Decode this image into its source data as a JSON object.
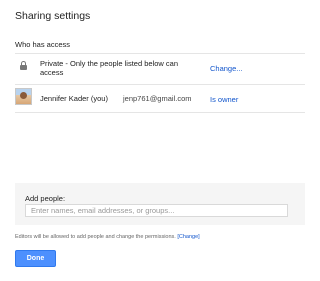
{
  "dialog": {
    "title": "Sharing settings",
    "access_section_label": "Who has access"
  },
  "access_rows": [
    {
      "icon": "lock-icon",
      "text_line1": "Private - Only the people listed below can",
      "text_line2": "access",
      "action": "Change..."
    },
    {
      "icon": "avatar",
      "name": "Jennifer Kader (you)",
      "email": "jenp761@gmail.com",
      "role": "Is owner"
    }
  ],
  "add_people": {
    "label": "Add people:",
    "placeholder": "Enter names, email addresses, or groups..."
  },
  "permissions_note": {
    "text": "Editors will be allowed to add people and change the permissions.",
    "link": "[Change]"
  },
  "footer": {
    "done_label": "Done"
  },
  "colors": {
    "link": "#1155cc",
    "primary_button": "#4d90fe",
    "panel_background": "#f5f5f5"
  }
}
